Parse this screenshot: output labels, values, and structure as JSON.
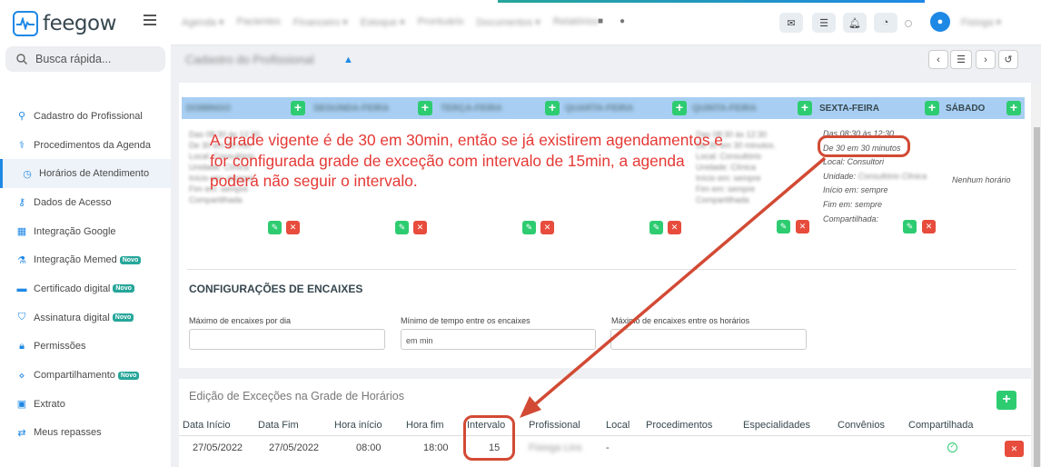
{
  "app": {
    "logo_text": "feegow"
  },
  "sidebar": {
    "search_placeholder": "Busca rápida...",
    "items": [
      {
        "label": "Cadastro do Profissional",
        "icon": "user-icon",
        "novo": false
      },
      {
        "label": "Procedimentos da Agenda",
        "icon": "stethoscope-icon",
        "novo": false
      },
      {
        "label": "Horários de Atendimento",
        "icon": "clock-icon",
        "novo": false,
        "active": true
      },
      {
        "label": "Dados de Acesso",
        "icon": "key-icon",
        "novo": false
      },
      {
        "label": "Integração Google",
        "icon": "calendar-icon",
        "novo": false
      },
      {
        "label": "Integração Memed",
        "icon": "flask-icon",
        "novo": true
      },
      {
        "label": "Certificado digital",
        "icon": "card-icon",
        "novo": true
      },
      {
        "label": "Assinatura digital",
        "icon": "shield-icon",
        "novo": true
      },
      {
        "label": "Permissões",
        "icon": "lock-icon",
        "novo": false
      },
      {
        "label": "Compartilhamento",
        "icon": "share-icon",
        "novo": true
      },
      {
        "label": "Extrato",
        "icon": "money-icon",
        "novo": false
      },
      {
        "label": "Meus repasses",
        "icon": "exchange-icon",
        "novo": false
      }
    ],
    "novo_badge": "Novo"
  },
  "days": {
    "friday": "SEXTA-FEIRA",
    "saturday": "SÁBADO"
  },
  "friday_schedule": {
    "time": "Das 08:30 às 12:30",
    "interval": "De 30 em 30 minutos",
    "local": "Local: Consultori",
    "unidade": "Unidade:",
    "inicio": "Início em: sempre",
    "fim": "Fim em: sempre",
    "compartilhada": "Compartilhada:"
  },
  "saturday_schedule": {
    "empty": "Nenhum horário"
  },
  "annotation": "A grade vigente é de 30 em 30min, então se já existirem agendamentos e for configurada grade de exceção com intervalo de 15min, a agenda poderá não seguir o intervalo.",
  "encaixes": {
    "title": "CONFIGURAÇÕES DE ENCAIXES",
    "max_per_day_label": "Máximo de encaixes por dia",
    "min_time_label": "Mínimo de tempo entre os encaixes",
    "min_time_placeholder": "em min",
    "max_between_label": "Máximo de encaixes entre os horários"
  },
  "exceptions": {
    "title": "Edição de Exceções na Grade de Horários",
    "headers": [
      "Data Início",
      "Data Fim",
      "Hora início",
      "Hora fim",
      "Intervalo",
      "Profissional",
      "Local",
      "Procedimentos",
      "Especialidades",
      "Convênios",
      "Compartilhada"
    ],
    "row": {
      "data_inicio": "27/05/2022",
      "data_fim": "27/05/2022",
      "hora_inicio": "08:00",
      "hora_fim": "18:00",
      "intervalo": "15",
      "local": "-"
    }
  },
  "colors": {
    "accent": "#1e88e5",
    "green": "#2ecc71",
    "red": "#e74c3c",
    "annotation": "#e53935"
  }
}
